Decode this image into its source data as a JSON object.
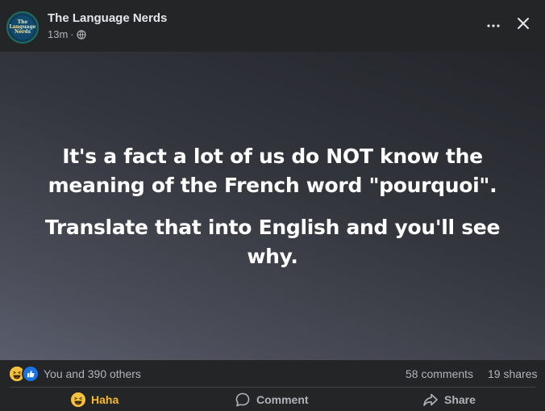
{
  "header": {
    "page_name": "The Language Nerds",
    "timestamp": "13m",
    "separator": "·",
    "avatar_text": "The Language Nerds",
    "privacy_icon": "globe-icon",
    "more_icon": "more-horizontal-icon",
    "close_icon": "close-icon"
  },
  "card": {
    "background_colors": [
      "#23252b",
      "#33363d",
      "#4a4d58",
      "#5a5d6c"
    ],
    "paragraph_1": "It's a fact a lot of us do NOT know the meaning of the French word \"pourquoi\".",
    "paragraph_2": "Translate that into English and you'll see why."
  },
  "summary": {
    "reactions": [
      "haha-reaction-icon",
      "like-reaction-icon"
    ],
    "reactors_text": "You and 390 others",
    "comments": "58 comments",
    "shares": "19 shares"
  },
  "actions": {
    "haha_label": "Haha",
    "comment_label": "Comment",
    "share_label": "Share"
  },
  "colors": {
    "background": "#242526",
    "text_primary": "#e4e6eb",
    "text_secondary": "#b0b3b8",
    "haha_accent": "#f7b928",
    "like_blue": "#1b74e4"
  }
}
